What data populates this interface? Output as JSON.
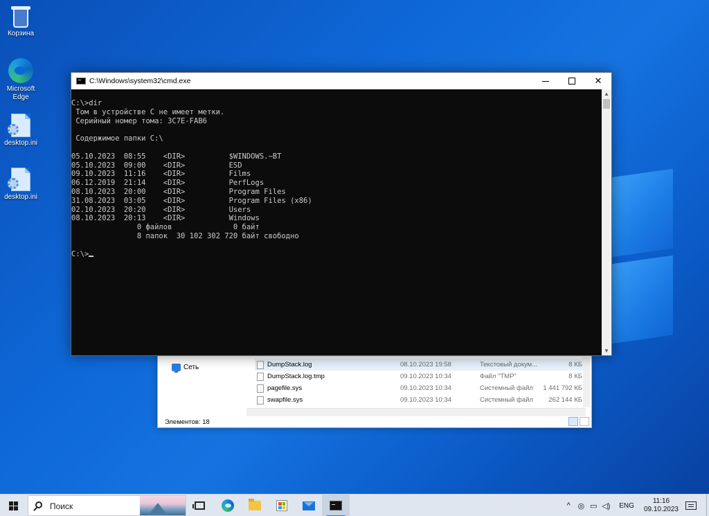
{
  "desktop": {
    "icons": [
      {
        "label": "Корзина",
        "icon": "recycle-bin-icon"
      },
      {
        "label": "Microsoft Edge",
        "icon": "edge-icon"
      },
      {
        "label": "desktop.ini",
        "icon": "ini-file-icon"
      },
      {
        "label": "desktop.ini",
        "icon": "ini-file-icon"
      }
    ]
  },
  "explorer": {
    "nav_network": "Сеть",
    "files": [
      {
        "name": "DumpStack.log",
        "date": "08.10.2023 19:58",
        "type": "Текстовый докум...",
        "size": "8 КБ"
      },
      {
        "name": "DumpStack.log.tmp",
        "date": "09.10.2023 10:34",
        "type": "Файл \"TMP\"",
        "size": "8 КБ"
      },
      {
        "name": "pagefile.sys",
        "date": "09.10.2023 10:34",
        "type": "Системный файл",
        "size": "1 441 792 КБ"
      },
      {
        "name": "swapfile.sys",
        "date": "09.10.2023 10:34",
        "type": "Системный файл",
        "size": "262 144 КБ"
      }
    ],
    "status": "Элементов: 18"
  },
  "cmd": {
    "title": "C:\\Windows\\system32\\cmd.exe",
    "lines": [
      "C:\\>dir",
      " Том в устройстве C не имеет метки.",
      " Серийный номер тома: 3C7E-FAB6",
      "",
      " Содержимое папки C:\\",
      "",
      "05.10.2023  08:55    <DIR>          $WINDOWS.~BT",
      "05.10.2023  09:00    <DIR>          ESD",
      "09.10.2023  11:16    <DIR>          Films",
      "06.12.2019  21:14    <DIR>          PerfLogs",
      "08.10.2023  20:00    <DIR>          Program Files",
      "31.08.2023  03:05    <DIR>          Program Files (x86)",
      "02.10.2023  20:20    <DIR>          Users",
      "08.10.2023  20:13    <DIR>          Windows",
      "               0 файлов              0 байт",
      "               8 папок  30 102 302 720 байт свободно",
      ""
    ],
    "prompt": "C:\\>",
    "buttons": {
      "minimize": "—",
      "maximize": "□",
      "close": "✕"
    }
  },
  "taskbar": {
    "search_placeholder": "Поиск",
    "apps": [
      {
        "name": "task-view",
        "icon": "task-view-icon"
      },
      {
        "name": "edge",
        "icon": "edge-icon"
      },
      {
        "name": "file-explorer",
        "icon": "folder-icon"
      },
      {
        "name": "store",
        "icon": "store-icon"
      },
      {
        "name": "mail",
        "icon": "mail-icon"
      },
      {
        "name": "cmd",
        "icon": "terminal-icon",
        "active": true
      }
    ],
    "tray": {
      "chevron": "^",
      "language": "ENG",
      "time": "11:16",
      "date": "09.10.2023"
    }
  },
  "colors": {
    "desktop_bg": "#0e67d6",
    "console_bg": "#0c0c0c",
    "console_text": "#cccccc",
    "accent": "#2b7cd3"
  }
}
